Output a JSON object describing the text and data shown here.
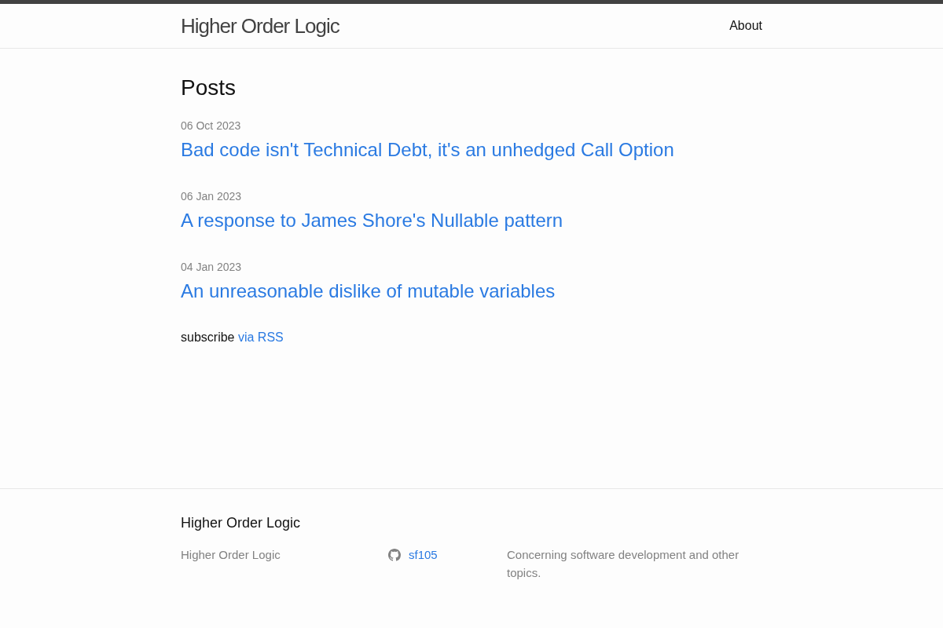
{
  "header": {
    "site_title": "Higher Order Logic",
    "nav": [
      {
        "label": "About"
      }
    ]
  },
  "main": {
    "heading": "Posts",
    "posts": [
      {
        "date": "06 Oct 2023",
        "title": "Bad code isn't Technical Debt, it's an unhedged Call Option"
      },
      {
        "date": "06 Jan 2023",
        "title": "A response to James Shore's Nullable pattern"
      },
      {
        "date": "04 Jan 2023",
        "title": "An unreasonable dislike of mutable variables"
      }
    ],
    "subscribe": {
      "text": "subscribe",
      "link": "via RSS"
    }
  },
  "footer": {
    "heading": "Higher Order Logic",
    "site_name": "Higher Order Logic",
    "github": {
      "username": "sf105"
    },
    "description": "Concerning software development and other topics."
  }
}
